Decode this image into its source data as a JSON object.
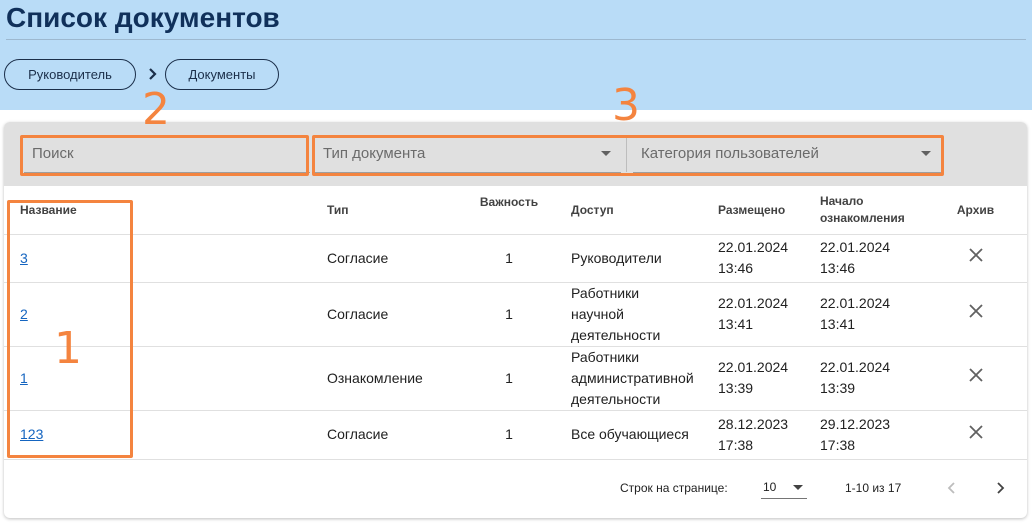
{
  "header": {
    "title": "Список документов",
    "breadcrumbs": [
      "Руководитель",
      "Документы"
    ]
  },
  "filters": {
    "search_placeholder": "Поиск",
    "doc_type_placeholder": "Тип документа",
    "user_category_placeholder": "Категория пользователей"
  },
  "table": {
    "columns": {
      "name": "Название",
      "type": "Тип",
      "importance": "Важность",
      "access": "Доступ",
      "placed": "Размещено",
      "start_line1": "Начало",
      "start_line2": "ознакомления",
      "archive": "Архив"
    },
    "rows": [
      {
        "name": "3",
        "type": "Согласие",
        "importance": "1",
        "access": [
          "Руководители"
        ],
        "placed_date": "22.01.2024",
        "placed_time": "13:46",
        "start_date": "22.01.2024",
        "start_time": "13:46"
      },
      {
        "name": "2",
        "type": "Согласие",
        "importance": "1",
        "access": [
          "Работники",
          "научной",
          "деятельности"
        ],
        "placed_date": "22.01.2024",
        "placed_time": "13:41",
        "start_date": "22.01.2024",
        "start_time": "13:41"
      },
      {
        "name": "1",
        "type": "Ознакомление",
        "importance": "1",
        "access": [
          "Работники",
          "административной",
          "деятельности"
        ],
        "placed_date": "22.01.2024",
        "placed_time": "13:39",
        "start_date": "22.01.2024",
        "start_time": "13:39"
      },
      {
        "name": "123",
        "type": "Согласие",
        "importance": "1",
        "access": [
          "Все обучающиеся"
        ],
        "placed_date": "28.12.2023",
        "placed_time": "17:38",
        "start_date": "29.12.2023",
        "start_time": "17:38"
      }
    ]
  },
  "pagination": {
    "rows_per_page_label": "Строк на странице:",
    "rows_per_page": "10",
    "range": "1-10 из 17"
  },
  "annotations": [
    "1",
    "2",
    "3"
  ],
  "colors": {
    "header_bg": "#b9dcf7",
    "title": "#10305a",
    "annotation": "#f4843f",
    "link": "#1565c0"
  },
  "icons": {
    "breadcrumb_separator": "chevron-right-icon",
    "archive": "close-icon",
    "dropdown": "caret-down-icon",
    "prev": "chevron-left-icon",
    "next": "chevron-right-icon"
  }
}
